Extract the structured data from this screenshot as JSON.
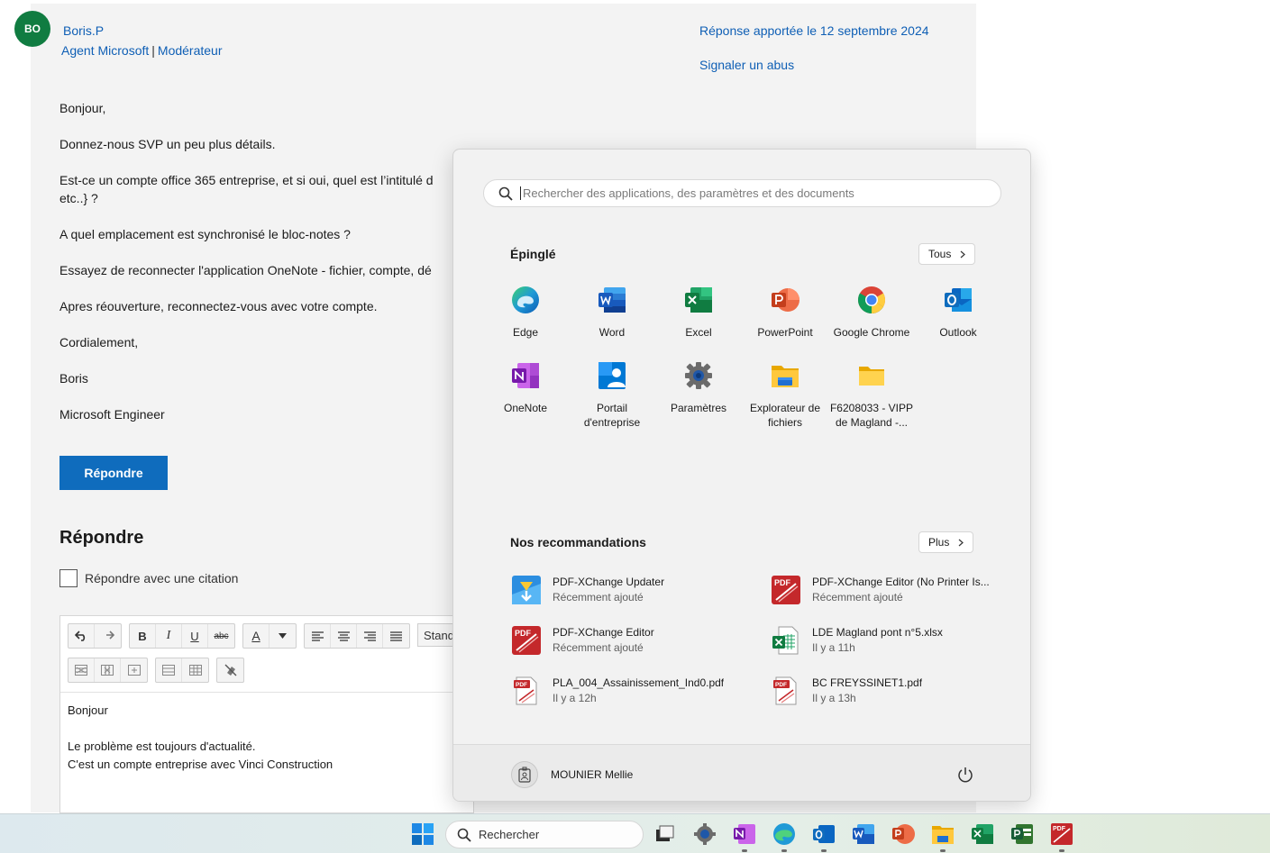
{
  "post": {
    "avatar_initials": "BO",
    "author": "Boris.P",
    "role_agent": "Agent Microsoft",
    "role_sep": "|",
    "role_moderator": "Modérateur",
    "reply_date": "Réponse apportée le 12 septembre 2024",
    "report_link": "Signaler un abus",
    "lines": [
      "Bonjour,",
      "Donnez-nous SVP un peu plus détails.",
      "Est-ce un compte office 365 entreprise, et si oui, quel est l’intitulé d",
      "etc..} ?",
      "A quel emplacement est synchronisé le bloc-notes ?",
      "Essayez de reconnecter l'application OneNote - fichier, compte, dé",
      "Apres réouverture, reconnectez-vous avec votre compte.",
      "Cordialement,",
      "Boris",
      "Microsoft Engineer"
    ],
    "reply_button": "Répondre"
  },
  "reply_form": {
    "title": "Répondre",
    "quote_label": "Répondre avec une citation",
    "style_value": "Standa",
    "toolbar": {
      "bold": "B",
      "italic": "I",
      "underline": "U",
      "strike": "abc",
      "font_color": "A"
    },
    "body_lines": [
      "Bonjour",
      "Le problème est toujours d'actualité.",
      "C'est un compte entreprise avec Vinci Construction"
    ]
  },
  "start_menu": {
    "search_placeholder": "Rechercher des applications, des paramètres et des documents",
    "pinned_title": "Épinglé",
    "pinned_all_button": "Tous",
    "pinned": [
      {
        "label": "Edge",
        "icon": "edge-icon"
      },
      {
        "label": "Word",
        "icon": "word-icon"
      },
      {
        "label": "Excel",
        "icon": "excel-icon"
      },
      {
        "label": "PowerPoint",
        "icon": "powerpoint-icon"
      },
      {
        "label": "Google Chrome",
        "icon": "chrome-icon"
      },
      {
        "label": "Outlook",
        "icon": "outlook-icon"
      },
      {
        "label": "OneNote",
        "icon": "onenote-icon"
      },
      {
        "label": "Portail d'entreprise",
        "icon": "company-portal-icon"
      },
      {
        "label": "Paramètres",
        "icon": "settings-icon"
      },
      {
        "label": "Explorateur de fichiers",
        "icon": "file-explorer-icon"
      },
      {
        "label": "F6208033 - VIPP de Magland -...",
        "icon": "folder-icon"
      }
    ],
    "recommended_title": "Nos recommandations",
    "recommended_more_button": "Plus",
    "recommended": [
      {
        "name": "PDF-XChange Updater",
        "sub": "Récemment ajouté",
        "icon": "pdf-updater-icon"
      },
      {
        "name": "PDF-XChange Editor (No Printer Is...",
        "sub": "Récemment ajouté",
        "icon": "pdf-editor-icon"
      },
      {
        "name": "PDF-XChange Editor",
        "sub": "Récemment ajouté",
        "icon": "pdf-editor-icon"
      },
      {
        "name": "LDE Magland pont n°5.xlsx",
        "sub": "Il y a 11h",
        "icon": "xlsx-file-icon"
      },
      {
        "name": "PLA_004_Assainissement_Ind0.pdf",
        "sub": "Il y a 12h",
        "icon": "pdf-file-icon"
      },
      {
        "name": "BC FREYSSINET1.pdf",
        "sub": "Il y a 13h",
        "icon": "pdf-file-icon"
      }
    ],
    "user_name": "MOUNIER Mellie",
    "pdf_badge": "PDF"
  },
  "taskbar": {
    "search_label": "Rechercher"
  },
  "colors": {
    "link": "#0f5fb5",
    "primary_button": "#0f6cbd",
    "avatar": "#107c41"
  }
}
